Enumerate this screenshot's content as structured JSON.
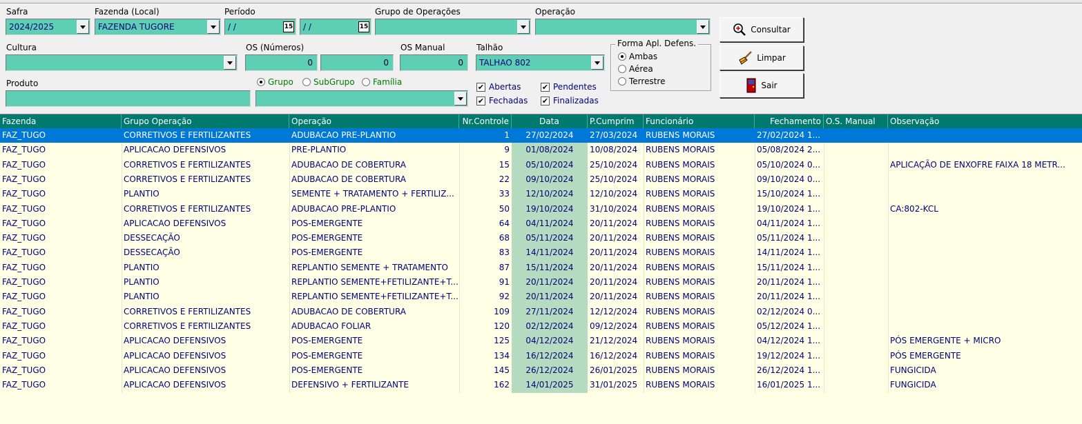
{
  "filters": {
    "safra": {
      "label": "Safra",
      "value": "2024/2025"
    },
    "fazenda": {
      "label": "Fazenda (Local)",
      "value": "FAZENDA TUGORE"
    },
    "periodo": {
      "label": "Período",
      "start": " / /",
      "end": " / /"
    },
    "grupo_operacoes": {
      "label": "Grupo de Operações",
      "value": ""
    },
    "operacao": {
      "label": "Operação",
      "value": ""
    },
    "cultura": {
      "label": "Cultura",
      "value": ""
    },
    "os_numeros": {
      "label": "OS (Números)",
      "from": "0",
      "to": "0"
    },
    "os_manual": {
      "label": "OS Manual",
      "value": "0"
    },
    "talhao": {
      "label": "Talhão",
      "value": "TALHAO 802"
    },
    "produto": {
      "label": "Produto",
      "value": "",
      "select_value": ""
    },
    "produto_scope": [
      {
        "label": "Grupo",
        "selected": true
      },
      {
        "label": "SubGrupo",
        "selected": false
      },
      {
        "label": "Família",
        "selected": false
      }
    ],
    "forma_aplicacao": {
      "title": "Forma Apl. Defens.",
      "options": [
        {
          "label": "Ambas",
          "selected": true
        },
        {
          "label": "Aérea",
          "selected": false
        },
        {
          "label": "Terrestre",
          "selected": false
        }
      ]
    },
    "status_checks": {
      "abertas": {
        "label": "Abertas",
        "checked": true
      },
      "fechadas": {
        "label": "Fechadas",
        "checked": true
      },
      "pendentes": {
        "label": "Pendentes",
        "checked": true
      },
      "finalizadas": {
        "label": "Finalizadas",
        "checked": true
      }
    }
  },
  "buttons": {
    "consultar": {
      "label": "Consultar",
      "icon": "magnifier-plus-icon"
    },
    "limpar": {
      "label": "Limpar",
      "icon": "broom-icon"
    },
    "sair": {
      "label": "Sair",
      "icon": "exit-door-icon"
    }
  },
  "grid": {
    "columns": [
      "Fazenda",
      "Grupo Operação",
      "Operação",
      "Nr.Controle",
      "Data",
      "P.Cumprim",
      "Funcionário",
      "Fechamento",
      "O.S. Manual",
      "Observação"
    ],
    "rows": [
      {
        "fazenda": "FAZ_TUGO",
        "grupo": "CORRETIVOS E FERTILIZANTES",
        "operacao": "ADUBACAO PRE-PLANTIO",
        "nr": "1",
        "data": "27/02/2024",
        "pcumprim": "27/03/2024",
        "funcionario": "RUBENS MORAIS",
        "fechamento": "27/02/2024 1...",
        "os_manual": "",
        "obs": ""
      },
      {
        "fazenda": "FAZ_TUGO",
        "grupo": "APLICACAO DEFENSIVOS",
        "operacao": "PRE-PLANTIO",
        "nr": "9",
        "data": "01/08/2024",
        "pcumprim": "10/08/2024",
        "funcionario": "RUBENS MORAIS",
        "fechamento": "05/08/2024 2...",
        "os_manual": "",
        "obs": ""
      },
      {
        "fazenda": "FAZ_TUGO",
        "grupo": "CORRETIVOS E FERTILIZANTES",
        "operacao": "ADUBACAO DE COBERTURA",
        "nr": "15",
        "data": "05/10/2024",
        "pcumprim": "25/10/2024",
        "funcionario": "RUBENS MORAIS",
        "fechamento": "05/10/2024 0...",
        "os_manual": "",
        "obs": "APLICAÇÃO DE ENXOFRE FAIXA 18 METR..."
      },
      {
        "fazenda": "FAZ_TUGO",
        "grupo": "CORRETIVOS E FERTILIZANTES",
        "operacao": "ADUBACAO DE COBERTURA",
        "nr": "22",
        "data": "09/10/2024",
        "pcumprim": "25/10/2024",
        "funcionario": "RUBENS MORAIS",
        "fechamento": "09/10/2024 0...",
        "os_manual": "",
        "obs": ""
      },
      {
        "fazenda": "FAZ_TUGO",
        "grupo": "PLANTIO",
        "operacao": "SEMENTE + TRATAMENTO + FERTILIZ...",
        "nr": "33",
        "data": "12/10/2024",
        "pcumprim": "12/10/2024",
        "funcionario": "RUBENS MORAIS",
        "fechamento": "15/10/2024 1...",
        "os_manual": "",
        "obs": ""
      },
      {
        "fazenda": "FAZ_TUGO",
        "grupo": "CORRETIVOS E FERTILIZANTES",
        "operacao": "ADUBACAO PRE-PLANTIO",
        "nr": "50",
        "data": "19/10/2024",
        "pcumprim": "31/10/2024",
        "funcionario": "RUBENS MORAIS",
        "fechamento": "19/10/2024 1...",
        "os_manual": "",
        "obs": "CA:802-KCL"
      },
      {
        "fazenda": "FAZ_TUGO",
        "grupo": "APLICACAO DEFENSIVOS",
        "operacao": "POS-EMERGENTE",
        "nr": "64",
        "data": "04/11/2024",
        "pcumprim": "20/11/2024",
        "funcionario": "RUBENS MORAIS",
        "fechamento": "04/11/2024 1...",
        "os_manual": "",
        "obs": ""
      },
      {
        "fazenda": "FAZ_TUGO",
        "grupo": "DESSECAÇÃO",
        "operacao": "POS-EMERGENTE",
        "nr": "68",
        "data": "05/11/2024",
        "pcumprim": "20/11/2024",
        "funcionario": "RUBENS MORAIS",
        "fechamento": "05/11/2024 1...",
        "os_manual": "",
        "obs": ""
      },
      {
        "fazenda": "FAZ_TUGO",
        "grupo": "DESSECAÇÃO",
        "operacao": "POS-EMERGENTE",
        "nr": "83",
        "data": "14/11/2024",
        "pcumprim": "20/11/2024",
        "funcionario": "RUBENS MORAIS",
        "fechamento": "14/11/2024 1...",
        "os_manual": "",
        "obs": ""
      },
      {
        "fazenda": "FAZ_TUGO",
        "grupo": "PLANTIO",
        "operacao": "REPLANTIO SEMENTE + TRATAMENTO",
        "nr": "87",
        "data": "15/11/2024",
        "pcumprim": "20/11/2024",
        "funcionario": "RUBENS MORAIS",
        "fechamento": "15/11/2024 1...",
        "os_manual": "",
        "obs": ""
      },
      {
        "fazenda": "FAZ_TUGO",
        "grupo": "PLANTIO",
        "operacao": "REPLANTIO SEMENTE+FETILIZANTE+T...",
        "nr": "91",
        "data": "20/11/2024",
        "pcumprim": "20/11/2024",
        "funcionario": "RUBENS MORAIS",
        "fechamento": "20/11/2024 1...",
        "os_manual": "",
        "obs": ""
      },
      {
        "fazenda": "FAZ_TUGO",
        "grupo": "PLANTIO",
        "operacao": "REPLANTIO SEMENTE+FETILIZANTE+T...",
        "nr": "92",
        "data": "20/11/2024",
        "pcumprim": "20/11/2024",
        "funcionario": "RUBENS MORAIS",
        "fechamento": "20/11/2024 1...",
        "os_manual": "",
        "obs": ""
      },
      {
        "fazenda": "FAZ_TUGO",
        "grupo": "CORRETIVOS E FERTILIZANTES",
        "operacao": "ADUBACAO DE COBERTURA",
        "nr": "109",
        "data": "27/11/2024",
        "pcumprim": "12/12/2024",
        "funcionario": "RUBENS MORAIS",
        "fechamento": "02/12/2024 0...",
        "os_manual": "",
        "obs": ""
      },
      {
        "fazenda": "FAZ_TUGO",
        "grupo": "CORRETIVOS E FERTILIZANTES",
        "operacao": "ADUBACAO FOLIAR",
        "nr": "120",
        "data": "02/12/2024",
        "pcumprim": "09/12/2024",
        "funcionario": "RUBENS MORAIS",
        "fechamento": "05/12/2024 1...",
        "os_manual": "",
        "obs": ""
      },
      {
        "fazenda": "FAZ_TUGO",
        "grupo": "APLICACAO DEFENSIVOS",
        "operacao": "POS-EMERGENTE",
        "nr": "125",
        "data": "04/12/2024",
        "pcumprim": "21/12/2024",
        "funcionario": "RUBENS MORAIS",
        "fechamento": "04/12/2024 1...",
        "os_manual": "",
        "obs": "PÓS EMERGENTE + MICRO"
      },
      {
        "fazenda": "FAZ_TUGO",
        "grupo": "APLICACAO DEFENSIVOS",
        "operacao": "POS-EMERGENTE",
        "nr": "134",
        "data": "16/12/2024",
        "pcumprim": "16/12/2024",
        "funcionario": "RUBENS MORAIS",
        "fechamento": "19/12/2024 1...",
        "os_manual": "",
        "obs": "PÓS EMERGENTE"
      },
      {
        "fazenda": "FAZ_TUGO",
        "grupo": "APLICACAO DEFENSIVOS",
        "operacao": "POS-EMERGENTE",
        "nr": "145",
        "data": "26/12/2024",
        "pcumprim": "26/01/2025",
        "funcionario": "RUBENS MORAIS",
        "fechamento": "26/12/2024 1...",
        "os_manual": "",
        "obs": "FUNGICIDA"
      },
      {
        "fazenda": "FAZ_TUGO",
        "grupo": "APLICACAO DEFENSIVOS",
        "operacao": "DEFENSIVO + FERTILIZANTE",
        "nr": "162",
        "data": "14/01/2025",
        "pcumprim": "31/01/2025",
        "funcionario": "RUBENS MORAIS",
        "fechamento": "16/01/2025 1...",
        "os_manual": "",
        "obs": "FUNGICIDA"
      }
    ],
    "selected_row": 0
  },
  "colors": {
    "field_bg": "#5ecfb4",
    "header_bg": "#007a6e",
    "grid_bg": "#ffffe6",
    "selection": "#0078d7",
    "date_col_bg": "#b5dcc0"
  }
}
